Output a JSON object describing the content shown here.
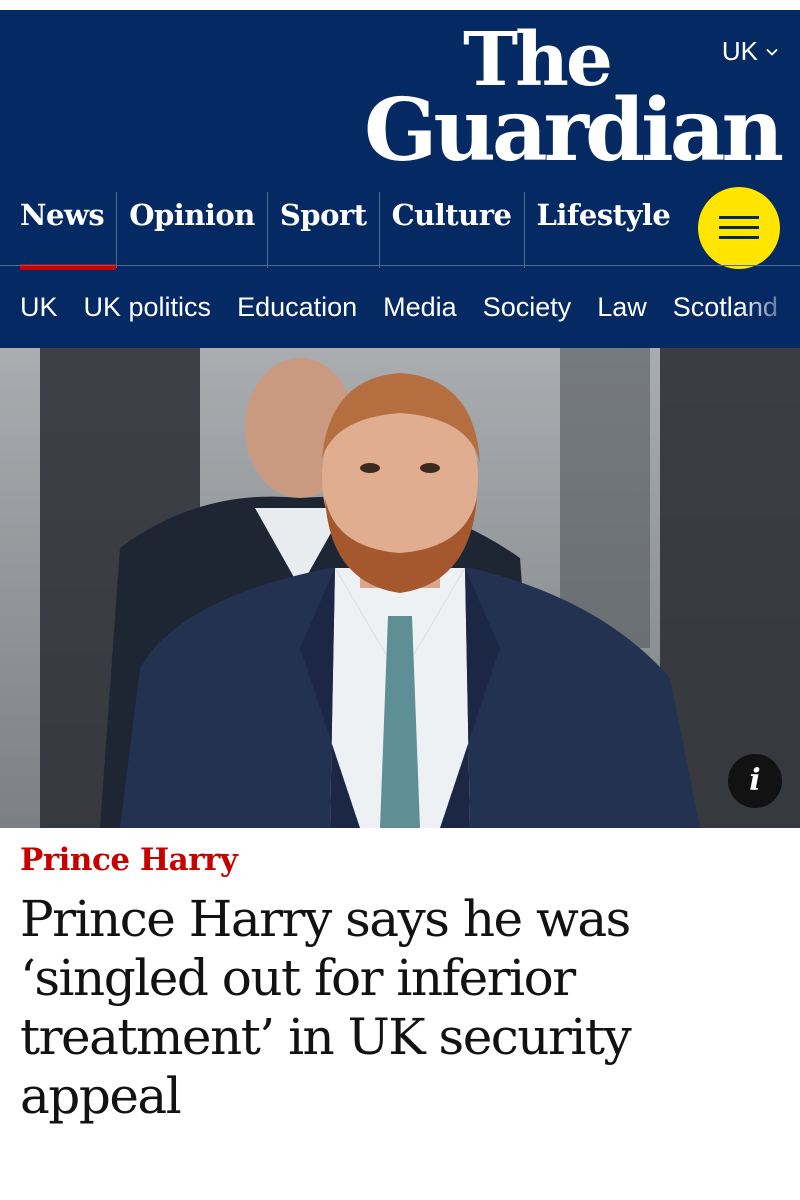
{
  "header": {
    "brand_line1": "The",
    "brand_line2": "Guardian",
    "edition": "UK",
    "pillars": [
      {
        "label": "News"
      },
      {
        "label": "Opinion"
      },
      {
        "label": "Sport"
      },
      {
        "label": "Culture"
      },
      {
        "label": "Lifestyle"
      }
    ],
    "active_pillar": "News",
    "menu_icon": "hamburger-icon",
    "colors": {
      "brand_blue": "#052962",
      "menu_yellow": "#ffe500",
      "news_red": "#c70000"
    }
  },
  "subnav": {
    "items": [
      "UK",
      "UK politics",
      "Education",
      "Media",
      "Society",
      "Law",
      "Scotland"
    ]
  },
  "article": {
    "info_icon_label": "i",
    "kicker": "Prince Harry",
    "headline": "Prince Harry says he was ‘singled out for inferior treatment’ in UK security appeal"
  }
}
